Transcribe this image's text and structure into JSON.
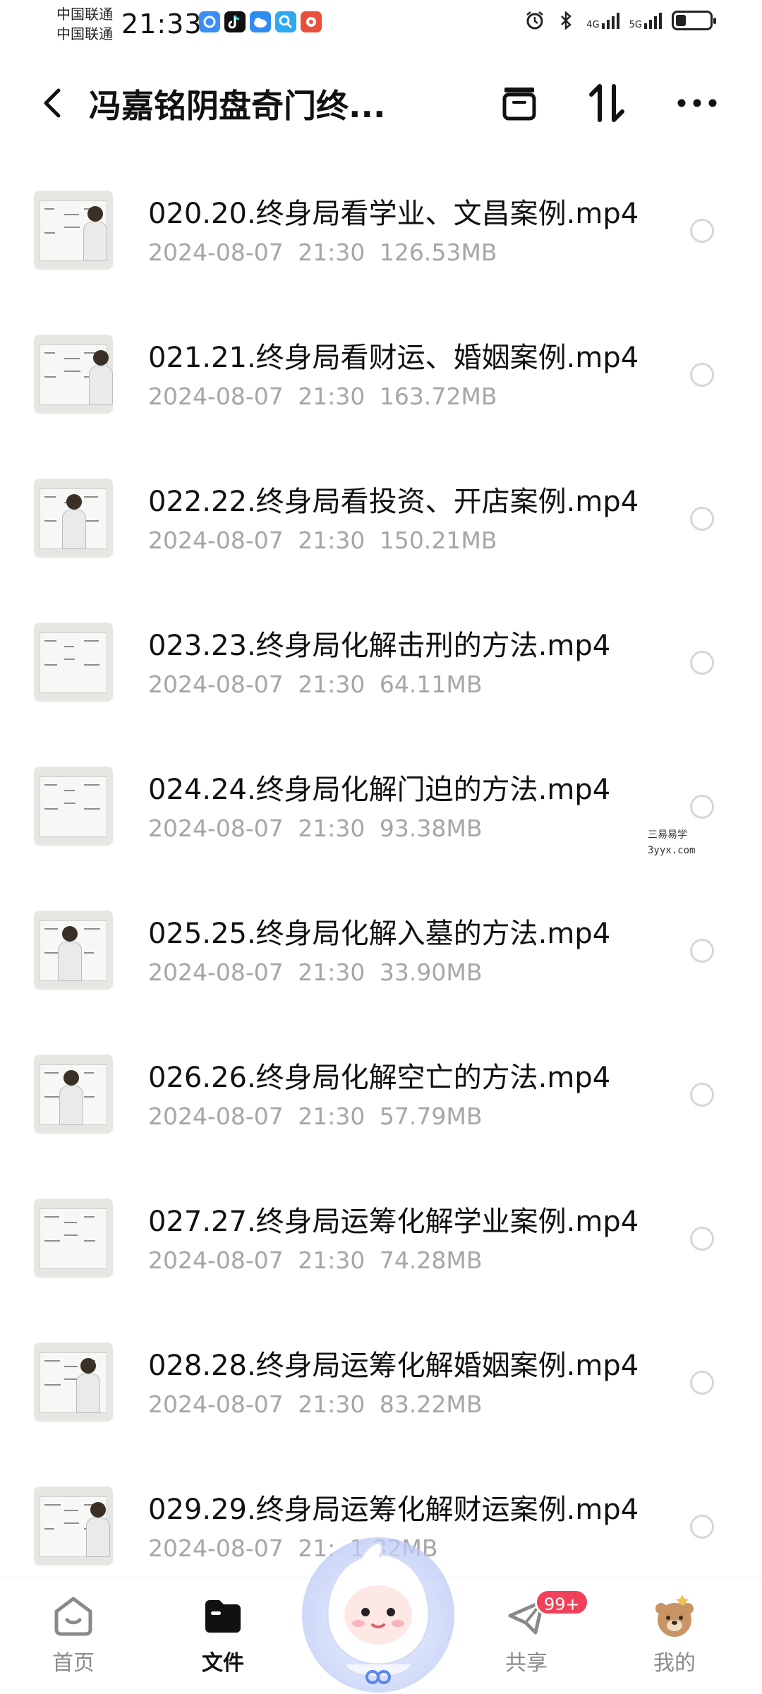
{
  "status_bar": {
    "carrier_1": "中国联通",
    "carrier_2": "中国联通",
    "time": "21:33",
    "net_1": "4G",
    "net_2": "5G",
    "battery_fraction": 0.3
  },
  "header": {
    "title": "冯嘉铭阴盘奇门终..."
  },
  "files": [
    {
      "name": "020.20.终身局看学业、文昌案例.mp4",
      "date": "2024-08-07",
      "time": "21:30",
      "size": "126.53MB"
    },
    {
      "name": "021.21.终身局看财运、婚姻案例.mp4",
      "date": "2024-08-07",
      "time": "21:30",
      "size": "163.72MB"
    },
    {
      "name": "022.22.终身局看投资、开店案例.mp4",
      "date": "2024-08-07",
      "time": "21:30",
      "size": "150.21MB"
    },
    {
      "name": "023.23.终身局化解击刑的方法.mp4",
      "date": "2024-08-07",
      "time": "21:30",
      "size": "64.11MB"
    },
    {
      "name": "024.24.终身局化解门迫的方法.mp4",
      "date": "2024-08-07",
      "time": "21:30",
      "size": "93.38MB"
    },
    {
      "name": "025.25.终身局化解入墓的方法.mp4",
      "date": "2024-08-07",
      "time": "21:30",
      "size": "33.90MB"
    },
    {
      "name": "026.26.终身局化解空亡的方法.mp4",
      "date": "2024-08-07",
      "time": "21:30",
      "size": "57.79MB"
    },
    {
      "name": "027.27.终身局运筹化解学业案例.mp4",
      "date": "2024-08-07",
      "time": "21:30",
      "size": "74.28MB"
    },
    {
      "name": "028.28.终身局运筹化解婚姻案例.mp4",
      "date": "2024-08-07",
      "time": "21:30",
      "size": "83.22MB"
    },
    {
      "name": "029.29.终身局运筹化解财运案例.mp4",
      "date": "2024-08-07",
      "time": "21:",
      "size": "1.82MB"
    }
  ],
  "watermark": {
    "line1": "三易易学",
    "line2": "3yyx.com"
  },
  "bottom_nav": {
    "items": [
      {
        "label": "首页",
        "icon": "home-icon"
      },
      {
        "label": "文件",
        "icon": "folder-icon"
      },
      {
        "label": "共享",
        "icon": "paper-plane-icon",
        "badge": "99+"
      },
      {
        "label": "我的",
        "icon": "bear-avatar-icon"
      }
    ],
    "active": "文件"
  },
  "colors": {
    "badge": "#f0405a",
    "meta_text": "#a6a6a6",
    "title_text": "#111111"
  }
}
